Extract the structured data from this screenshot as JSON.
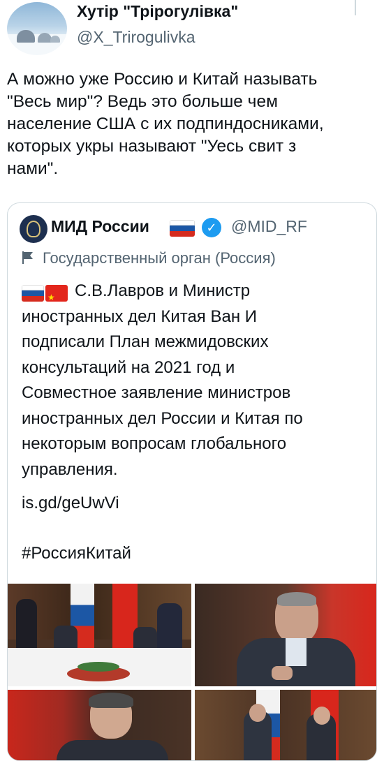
{
  "tweet": {
    "author_name": "Хутір \"Трірогулівка\"",
    "author_handle": "@X_Trirogulivka",
    "text": "А можно уже Россию и Китай называть\n\"Весь мир\"? Ведь это больше чем\nнаселение США с их подпиндосниками,\nкоторых укры называют \"Уесь свит з\nнами\"."
  },
  "quote": {
    "author_name": "МИД России",
    "author_handle": "@MID_RF",
    "account_label": "Государственный орган (Россия)",
    "text": "С.В.Лавров и Министр\nиностранных дел Китая Ван И\nподписали План межмидовских\nконсультаций на 2021 год и\nСовместное заявление министров\nиностранных дел России и Китая по\nнекоторым вопросам глобального\nуправления.",
    "link": "is.gd/geUwVi",
    "hashtag": "#РоссияКитай",
    "photos": [
      "photo-signing-table",
      "photo-lavrov-signing",
      "photo-wang-yi",
      "photo-handshake"
    ]
  },
  "colors": {
    "text": "#0f1419",
    "secondary": "#536471",
    "border": "#cfd9de",
    "verified": "#1d9bf0"
  }
}
